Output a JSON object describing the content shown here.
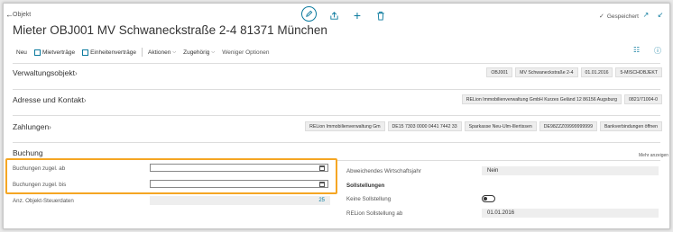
{
  "header": {
    "breadcrumb": "Objekt",
    "title": "Mieter OBJ001 MV Schwaneckstraße 2-4 81371 München",
    "saved_label": "Gespeichert"
  },
  "actionbar": {
    "neu": "Neu",
    "mietvertraege": "Mietverträge",
    "einheitenvertraege": "Einheitenverträge",
    "aktionen": "Aktionen",
    "zugehoerig": "Zugehörig",
    "weniger": "Weniger Optionen"
  },
  "sections": {
    "verwaltungsobjekt": {
      "title": "Verwaltungsobjekt",
      "chips": [
        "OBJ001",
        "MV Schwaneckstraße 2-4",
        "01.01.2016",
        "5-MISCHOBJEKT"
      ]
    },
    "adresse": {
      "title": "Adresse und Kontakt",
      "chips": [
        "RELion Immobilienverwaltung GmbH Kurzes Geländ 12 86156 Augsburg",
        "0821/71004-0"
      ]
    },
    "zahlungen": {
      "title": "Zahlungen",
      "chips": [
        "RELion Immobilienverwaltung Gm",
        "DE15 7303 0000 0441 7442 33",
        "Sparkasse Neu-Ulm-Illertissen",
        "DE98ZZZ09999999999",
        "Bankverbindungen öffnen"
      ]
    },
    "buchung": {
      "title": "Buchung",
      "mehr": "Mehr anzeigen",
      "buchungen_ab_label": "Buchungen zugel. ab",
      "buchungen_ab_value": "",
      "buchungen_bis_label": "Buchungen zugel. bis",
      "buchungen_bis_value": "",
      "anz_label": "Anz. Objekt-Steuerdaten",
      "anz_value": "25",
      "abw_label": "Abweichendes Wirtschaftsjahr",
      "abw_value": "Nein",
      "sollstellungen_head": "Sollstellungen",
      "keine_label": "Keine Sollstellung",
      "keine_on": false,
      "relion_label": "RELion Sollstellung ab",
      "relion_value": "01.01.2016"
    }
  },
  "colors": {
    "accent": "#0b7a9e",
    "highlight": "#f5a623"
  }
}
